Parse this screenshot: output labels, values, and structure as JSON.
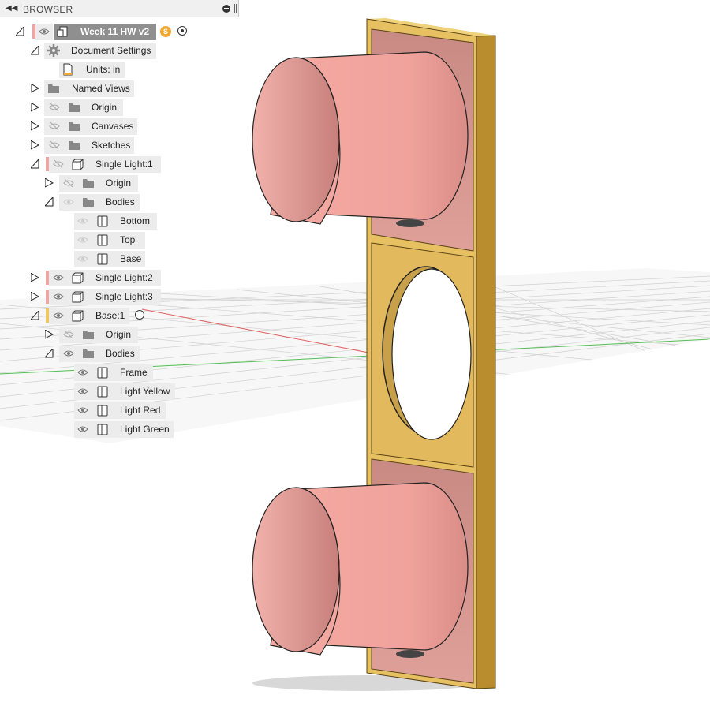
{
  "browser": {
    "title": "BROWSER",
    "items": [
      {
        "label": "Week 11 HW v2",
        "badge": "S"
      },
      {
        "label": "Document Settings"
      },
      {
        "label": "Units: in"
      },
      {
        "label": "Named Views"
      },
      {
        "label": "Origin"
      },
      {
        "label": "Canvases"
      },
      {
        "label": "Sketches"
      },
      {
        "label": "Single Light:1"
      },
      {
        "label": "Origin"
      },
      {
        "label": "Bodies"
      },
      {
        "label": "Bottom"
      },
      {
        "label": "Top"
      },
      {
        "label": "Base"
      },
      {
        "label": "Single Light:2"
      },
      {
        "label": "Single Light:3"
      },
      {
        "label": "Base:1"
      },
      {
        "label": "Origin"
      },
      {
        "label": "Bodies"
      },
      {
        "label": "Frame"
      },
      {
        "label": "Light Yellow"
      },
      {
        "label": "Light Red"
      },
      {
        "label": "Light Green"
      }
    ]
  },
  "colors": {
    "frame": "#e7c062",
    "light_body": "#f0a09a",
    "component_marker": "#f2a3a3",
    "base_marker": "#f2c65a",
    "grid_red_axis": "#e05050",
    "grid_green_axis": "#40c040"
  }
}
